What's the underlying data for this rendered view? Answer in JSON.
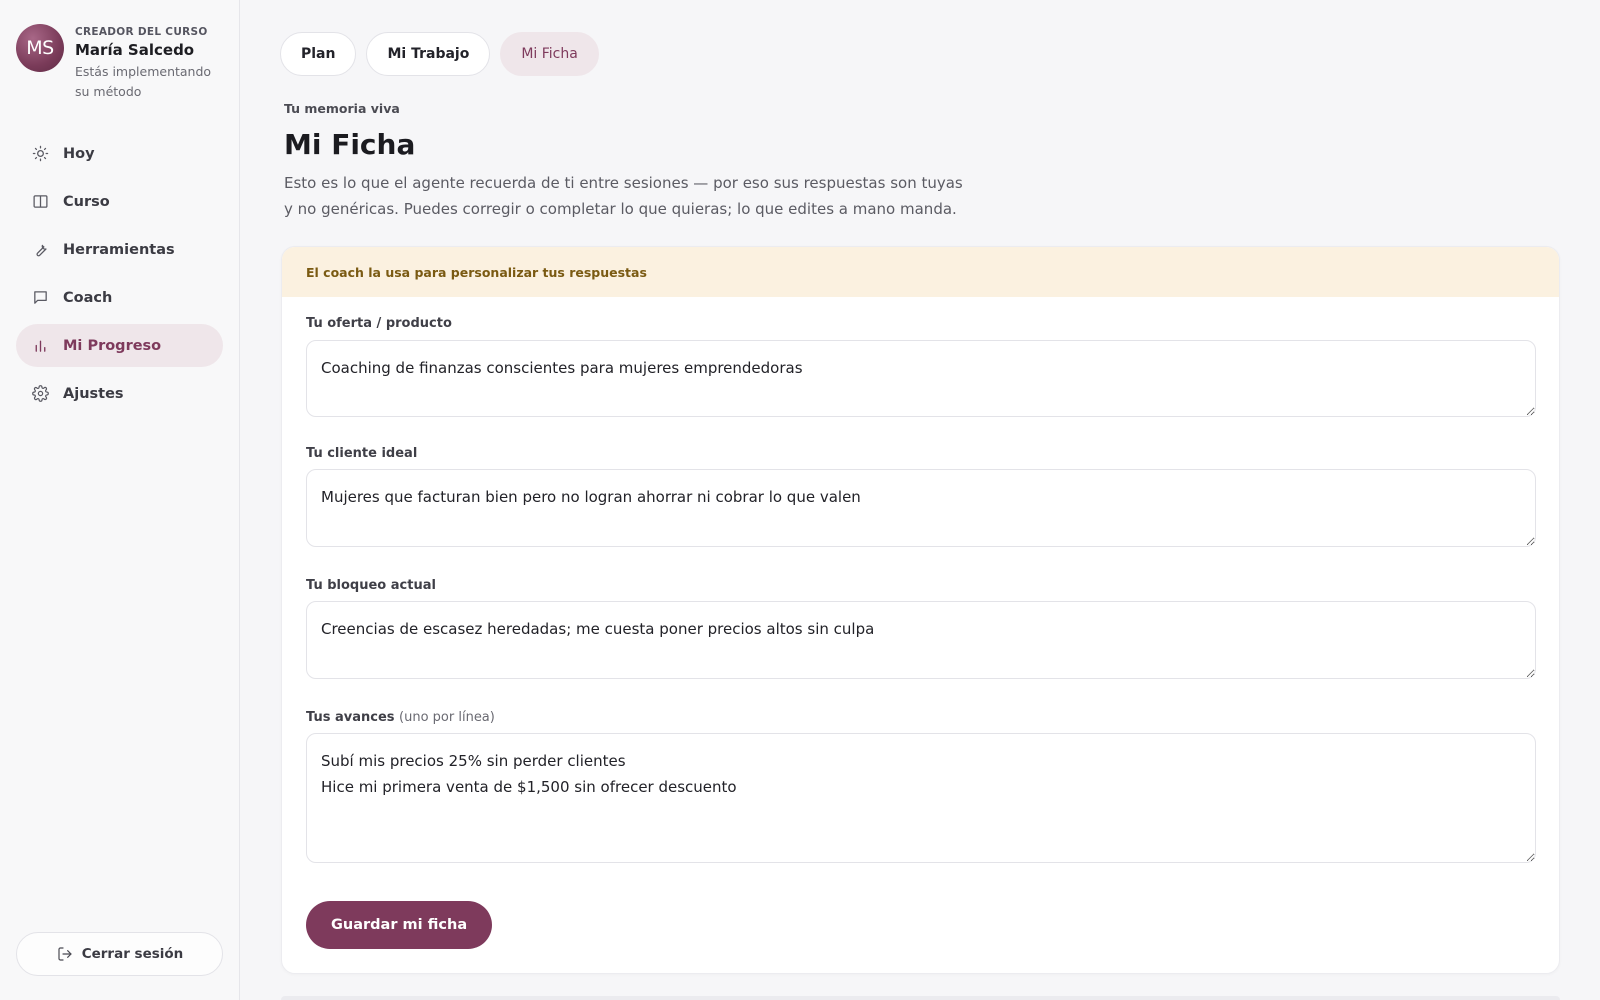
{
  "profile": {
    "initials": "MS",
    "role": "CREADOR DEL CURSO",
    "name": "María Salcedo",
    "subtitle": "Estás implementando su método"
  },
  "sidebar": {
    "items": [
      {
        "label": "Hoy",
        "icon": "sun-icon"
      },
      {
        "label": "Curso",
        "icon": "book-icon"
      },
      {
        "label": "Herramientas",
        "icon": "wrench-icon"
      },
      {
        "label": "Coach",
        "icon": "chat-icon"
      },
      {
        "label": "Mi Progreso",
        "icon": "bar-chart-icon",
        "active": true
      },
      {
        "label": "Ajustes",
        "icon": "gear-icon"
      }
    ],
    "logout_label": "Cerrar sesión"
  },
  "tabs": [
    {
      "label": "Plan"
    },
    {
      "label": "Mi Trabajo"
    },
    {
      "label": "Mi Ficha",
      "active": true
    }
  ],
  "header": {
    "eyebrow": "Tu memoria viva",
    "title": "Mi Ficha",
    "description": "Esto es lo que el agente recuerda de ti entre sesiones — por eso sus respuestas son tuyas y no genéricas. Puedes corregir o completar lo que quieras; lo que edites a mano manda."
  },
  "card": {
    "banner": "El coach la usa para personalizar tus respuestas",
    "fields": {
      "offer": {
        "label": "Tu oferta / producto",
        "value": "Coaching de finanzas conscientes para mujeres emprendedoras"
      },
      "client": {
        "label": "Tu cliente ideal",
        "value": "Mujeres que facturan bien pero no logran ahorrar ni cobrar lo que valen"
      },
      "block": {
        "label": "Tu bloqueo actual",
        "value": "Creencias de escasez heredadas; me cuesta poner precios altos sin culpa"
      },
      "progress": {
        "label": "Tus avances",
        "hint": "(uno por línea)",
        "value": "Subí mis precios 25% sin perder clientes\nHice mi primera venta de $1,500 sin ofrecer descuento"
      }
    },
    "save_label": "Guardar mi ficha"
  },
  "colors": {
    "accent": "#7e3a5c",
    "accent_soft": "#efe6ea",
    "banner_bg": "#fbf1e0",
    "banner_text": "#7a5a12"
  }
}
